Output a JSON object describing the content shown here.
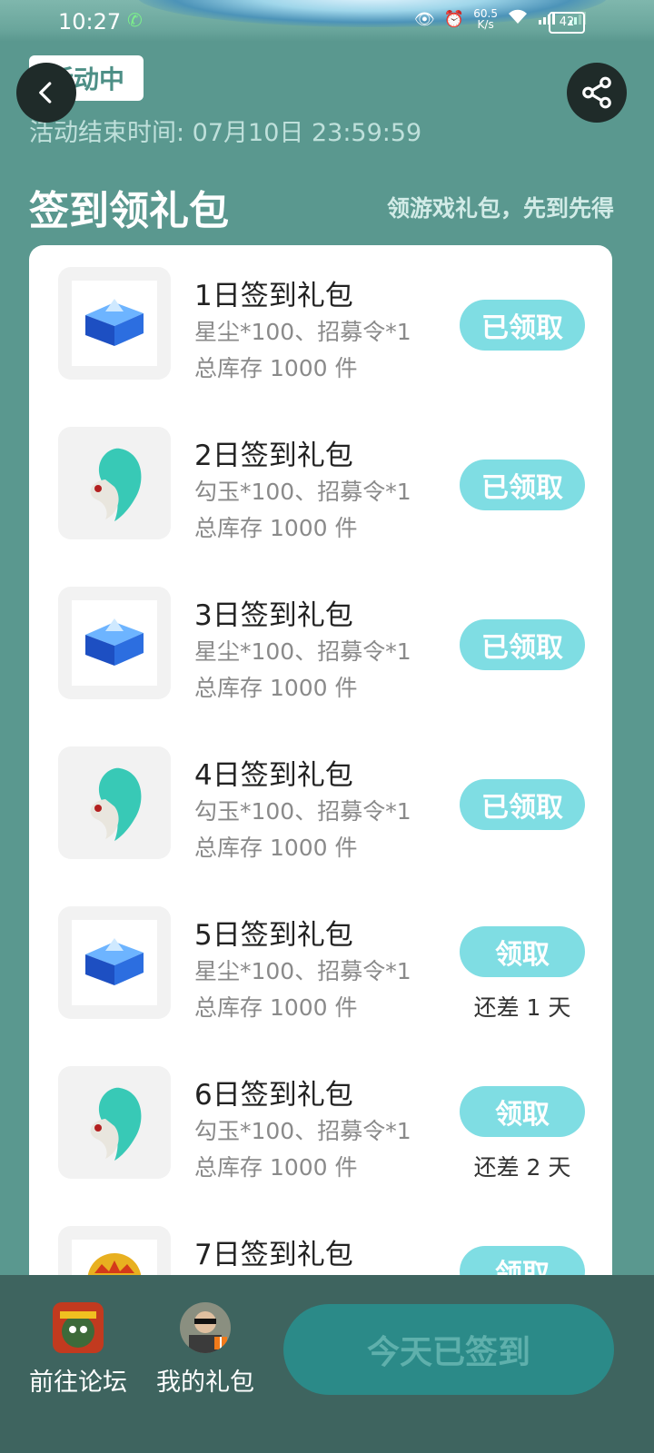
{
  "status_bar": {
    "time": "10:27",
    "net_speed": "60.5\nK/s",
    "battery": "42"
  },
  "header": {
    "badge": "活动中",
    "end_time": "活动结束时间: 07月10日 23:59:59"
  },
  "section": {
    "title": "签到领礼包",
    "subtitle": "领游戏礼包，先到先得"
  },
  "gifts": [
    {
      "title": "1日签到礼包",
      "desc": "星尘*100、招募令*1",
      "stock": "总库存 1000 件",
      "button": "已领取",
      "icon": "crystal-chest-icon"
    },
    {
      "title": "2日签到礼包",
      "desc": "勾玉*100、招募令*1",
      "stock": "总库存 1000 件",
      "button": "已领取",
      "icon": "jade-magatama-icon"
    },
    {
      "title": "3日签到礼包",
      "desc": "星尘*100、招募令*1",
      "stock": "总库存 1000 件",
      "button": "已领取",
      "icon": "crystal-chest-icon"
    },
    {
      "title": "4日签到礼包",
      "desc": "勾玉*100、招募令*1",
      "stock": "总库存 1000 件",
      "button": "已领取",
      "icon": "jade-magatama-icon"
    },
    {
      "title": "5日签到礼包",
      "desc": "星尘*100、招募令*1",
      "stock": "总库存 1000 件",
      "button": "领取",
      "remain": "还差 1 天",
      "icon": "crystal-chest-icon"
    },
    {
      "title": "6日签到礼包",
      "desc": "勾玉*100、招募令*1",
      "stock": "总库存 1000 件",
      "button": "领取",
      "remain": "还差 2 天",
      "icon": "jade-magatama-icon"
    },
    {
      "title": "7日签到礼包",
      "button": "领取",
      "icon": "lion-mask-icon"
    }
  ],
  "bottom_bar": {
    "forum_label": "前往论坛",
    "my_gifts_label": "我的礼包",
    "signed_button": "今天已签到"
  },
  "colors": {
    "background": "#5a988f",
    "claimed_button": "#7fdde3",
    "bottom_bar": "#3e645f",
    "signed_button": "#2b8a88"
  }
}
